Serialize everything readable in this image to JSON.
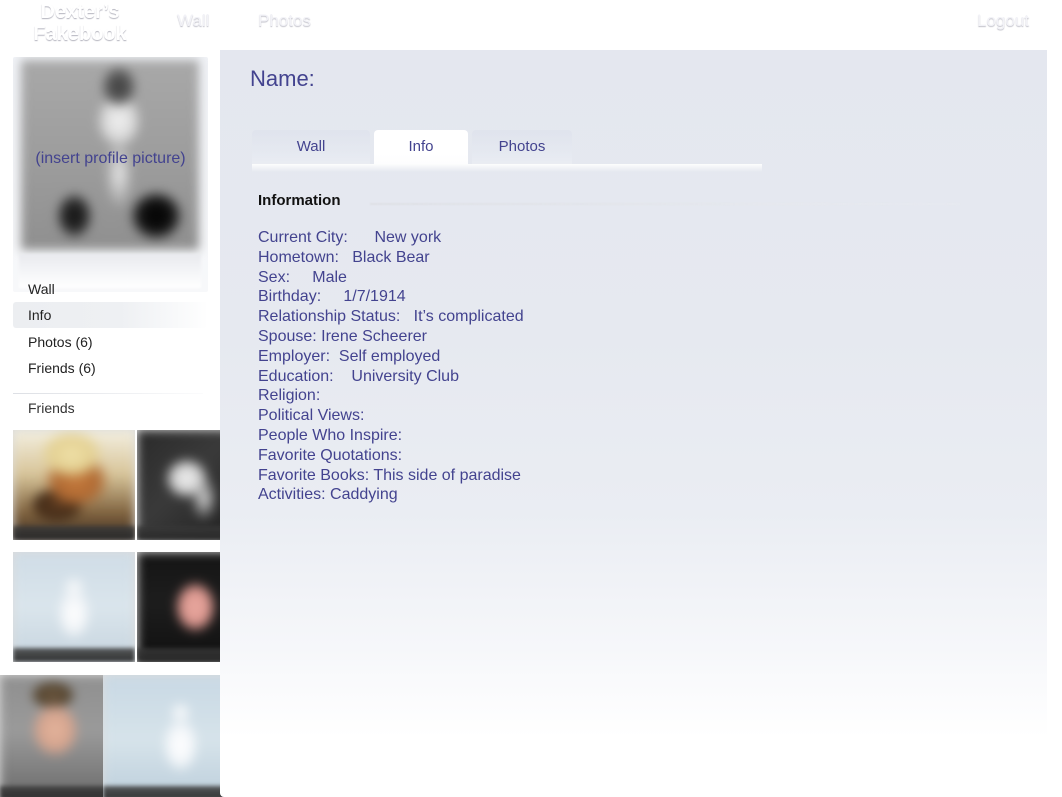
{
  "header": {
    "brand_line1": "Dexter’s",
    "brand_line2": "Fakebook",
    "nav": [
      {
        "label": "Wall"
      },
      {
        "label": "Photos"
      }
    ],
    "logout_label": "Logout",
    "gradient_top_color": "#6d71a0",
    "gradient_bottom_color": "#e2e3ee",
    "text_color": "#f2f2f7"
  },
  "sidebar": {
    "profile_picture_placeholder": "(insert profile picture)",
    "links": [
      {
        "label": "Wall",
        "active": false
      },
      {
        "label": "Info",
        "active": true
      },
      {
        "label": "Photos (6)",
        "active": false
      },
      {
        "label": "Friends (6)",
        "active": false
      }
    ],
    "friends_heading": "Friends",
    "friend_photos": [
      {
        "name": "friend-photo-1"
      },
      {
        "name": "friend-photo-2"
      },
      {
        "name": "friend-photo-3"
      },
      {
        "name": "friend-photo-4"
      },
      {
        "name": "friend-photo-5"
      },
      {
        "name": "friend-photo-6"
      }
    ]
  },
  "main": {
    "page_title": "Name:",
    "tabs": [
      {
        "label": "Wall",
        "active": false
      },
      {
        "label": "Info",
        "active": true
      },
      {
        "label": "Photos",
        "active": false
      }
    ],
    "section_heading": "Information",
    "info_rows": [
      {
        "label": "Current City:",
        "value": "New york",
        "text": "Current City:      New york"
      },
      {
        "label": "Hometown:",
        "value": "Black Bear",
        "text": "Hometown:   Black Bear"
      },
      {
        "label": "Sex:",
        "value": "Male",
        "text": "Sex:     Male"
      },
      {
        "label": "Birthday:",
        "value": "1/7/1914",
        "text": "Birthday:     1/7/1914"
      },
      {
        "label": "Relationship Status:",
        "value": "It’s complicated",
        "text": "Relationship Status:   It’s complicated"
      },
      {
        "label": "Spouse:",
        "value": "Irene Scheerer",
        "text": "Spouse: Irene Scheerer"
      },
      {
        "label": "Employer:",
        "value": "Self employed",
        "text": "Employer:  Self employed"
      },
      {
        "label": "Education:",
        "value": "University Club",
        "text": "Education:    University Club"
      },
      {
        "label": "Religion:",
        "value": "",
        "text": "Religion:"
      },
      {
        "label": "Political Views:",
        "value": "",
        "text": "Political Views:"
      },
      {
        "label": "People Who Inspire:",
        "value": "",
        "text": "People Who Inspire:"
      },
      {
        "label": "Favorite Quotations:",
        "value": "",
        "text": "Favorite Quotations:"
      },
      {
        "label": "Favorite Books:",
        "value": "This side of paradise",
        "text": "Favorite Books: This side of paradise"
      },
      {
        "label": "Activities:",
        "value": "Caddying",
        "text": "Activities: Caddying"
      }
    ],
    "text_color": "#43438f",
    "panel_color": "#e6e9f0"
  }
}
